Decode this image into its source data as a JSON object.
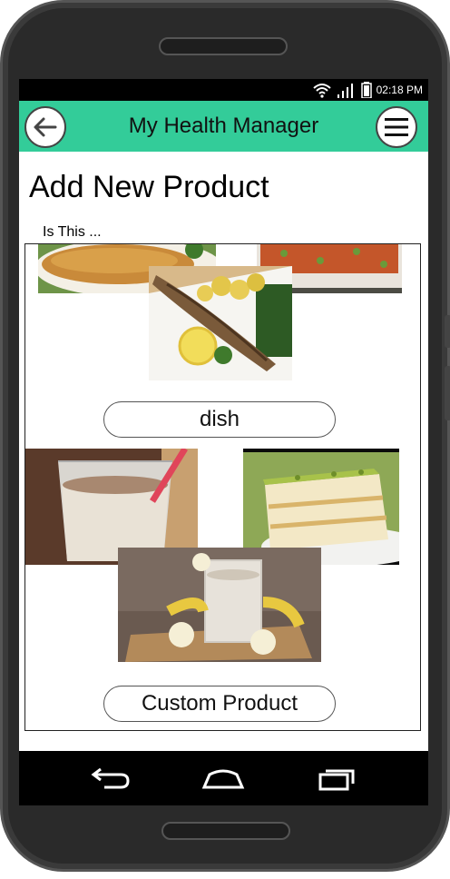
{
  "status_bar": {
    "time": "02:18 PM",
    "icons": [
      "wifi-icon",
      "signal-icon",
      "battery-icon"
    ]
  },
  "app_bar": {
    "title": "My Health Manager",
    "back_icon": "arrow-left-icon",
    "menu_icon": "hamburger-menu-icon",
    "color": "#33cc99"
  },
  "page": {
    "title": "Add New Product",
    "prompt": "Is This ..."
  },
  "groups": [
    {
      "images": [
        "fried-cutlet-photo",
        "rice-dish-photo",
        "grilled-fish-photo"
      ],
      "button_label": "dish"
    },
    {
      "images": [
        "milkshake-photo",
        "layer-cake-photo",
        "banana-smoothie-photo"
      ],
      "button_label": "Custom Product"
    }
  ],
  "nav_bar": {
    "icons": [
      "back-nav-icon",
      "home-nav-icon",
      "recent-apps-icon"
    ]
  }
}
